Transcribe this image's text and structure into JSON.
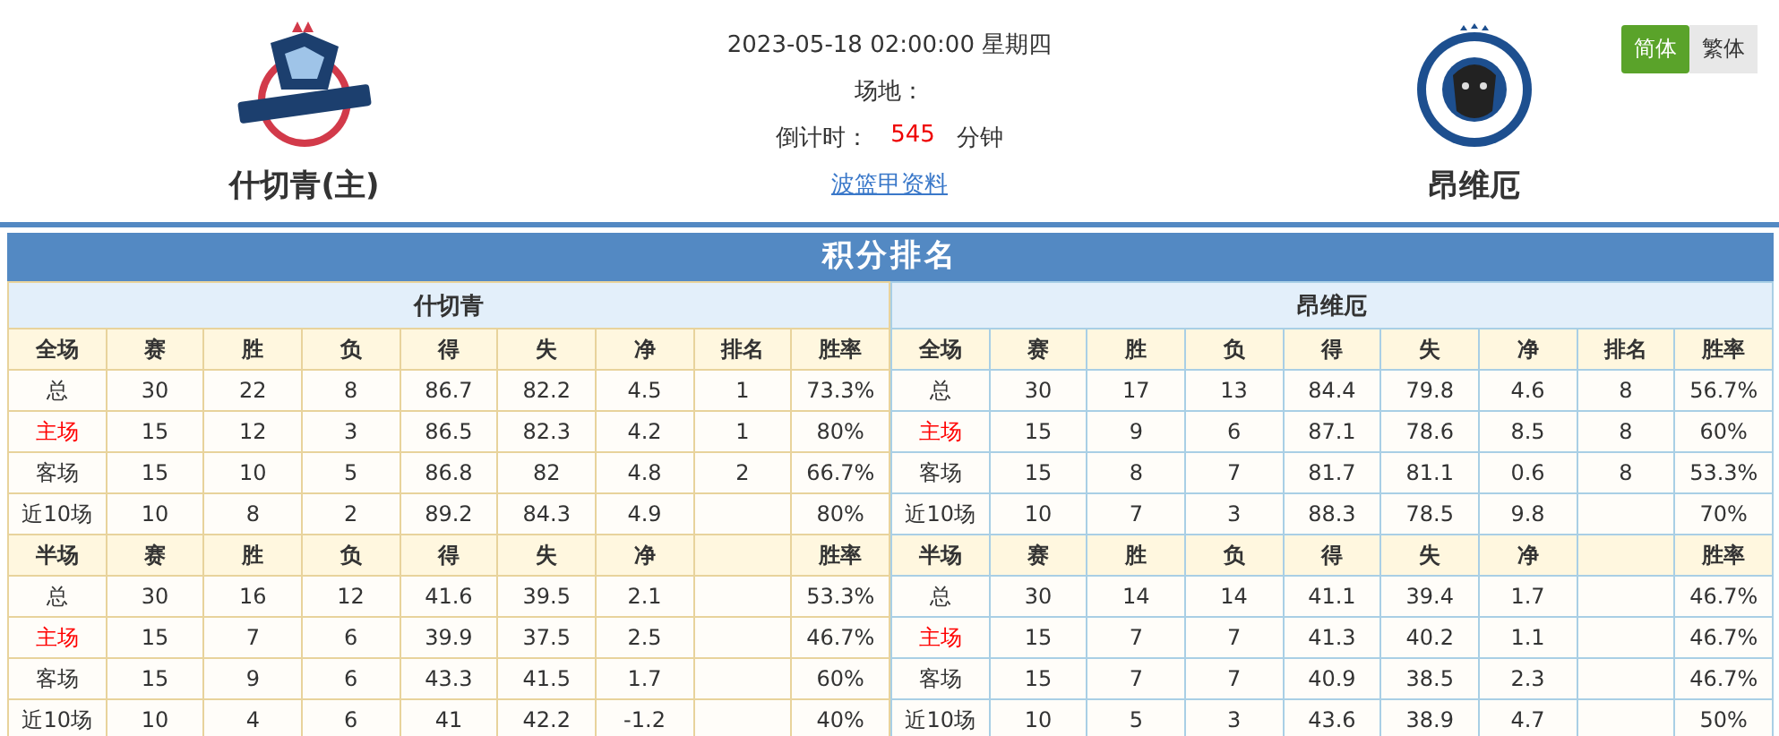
{
  "header": {
    "datetime": "2023-05-18 02:00:00 星期四",
    "venue_label": "场地：",
    "countdown_label": "倒计时：",
    "countdown_value": "545",
    "countdown_unit": "分钟",
    "link": "波篮甲资料",
    "home": {
      "name": "什切青(主)"
    },
    "away": {
      "name": "昂维厄"
    }
  },
  "lang_toggle": [
    {
      "label": "简体",
      "selected": true
    },
    {
      "label": "繁体",
      "selected": false
    }
  ],
  "standings": {
    "title": "积分排名",
    "tables": [
      {
        "team": "什切青",
        "sections": [
          {
            "header": {
              "label": "全场",
              "games": "赛",
              "wins": "胜",
              "losses": "负",
              "scored": "得",
              "conceded": "失",
              "net": "净",
              "rank": "排名",
              "win_rate": "胜率"
            },
            "rows": [
              {
                "highlight": false,
                "label": "总",
                "games": "30",
                "wins": "22",
                "losses": "8",
                "scored": "86.7",
                "conceded": "82.2",
                "net": "4.5",
                "rank": "1",
                "win_rate": "73.3%"
              },
              {
                "highlight": true,
                "label": "主场",
                "games": "15",
                "wins": "12",
                "losses": "3",
                "scored": "86.5",
                "conceded": "82.3",
                "net": "4.2",
                "rank": "1",
                "win_rate": "80%"
              },
              {
                "highlight": false,
                "label": "客场",
                "games": "15",
                "wins": "10",
                "losses": "5",
                "scored": "86.8",
                "conceded": "82",
                "net": "4.8",
                "rank": "2",
                "win_rate": "66.7%"
              },
              {
                "highlight": false,
                "label": "近10场",
                "games": "10",
                "wins": "8",
                "losses": "2",
                "scored": "89.2",
                "conceded": "84.3",
                "net": "4.9",
                "win_rate": "80%"
              }
            ]
          },
          {
            "header": {
              "label": "半场",
              "games": "赛",
              "wins": "胜",
              "losses": "负",
              "scored": "得",
              "conceded": "失",
              "net": "净",
              "win_rate": "胜率"
            },
            "rows": [
              {
                "highlight": false,
                "label": "总",
                "games": "30",
                "wins": "16",
                "losses": "12",
                "scored": "41.6",
                "conceded": "39.5",
                "net": "2.1",
                "win_rate": "53.3%"
              },
              {
                "highlight": true,
                "label": "主场",
                "games": "15",
                "wins": "7",
                "losses": "6",
                "scored": "39.9",
                "conceded": "37.5",
                "net": "2.5",
                "win_rate": "46.7%"
              },
              {
                "highlight": false,
                "label": "客场",
                "games": "15",
                "wins": "9",
                "losses": "6",
                "scored": "43.3",
                "conceded": "41.5",
                "net": "1.7",
                "win_rate": "60%"
              },
              {
                "highlight": false,
                "label": "近10场",
                "games": "10",
                "wins": "4",
                "losses": "6",
                "scored": "41",
                "conceded": "42.2",
                "net": "-1.2",
                "win_rate": "40%"
              }
            ]
          }
        ]
      },
      {
        "team": "昂维厄",
        "sections": [
          {
            "header": {
              "label": "全场",
              "games": "赛",
              "wins": "胜",
              "losses": "负",
              "scored": "得",
              "conceded": "失",
              "net": "净",
              "rank": "排名",
              "win_rate": "胜率"
            },
            "rows": [
              {
                "highlight": false,
                "label": "总",
                "games": "30",
                "wins": "17",
                "losses": "13",
                "scored": "84.4",
                "conceded": "79.8",
                "net": "4.6",
                "rank": "8",
                "win_rate": "56.7%"
              },
              {
                "highlight": true,
                "label": "主场",
                "games": "15",
                "wins": "9",
                "losses": "6",
                "scored": "87.1",
                "conceded": "78.6",
                "net": "8.5",
                "rank": "8",
                "win_rate": "60%"
              },
              {
                "highlight": false,
                "label": "客场",
                "games": "15",
                "wins": "8",
                "losses": "7",
                "scored": "81.7",
                "conceded": "81.1",
                "net": "0.6",
                "rank": "8",
                "win_rate": "53.3%"
              },
              {
                "highlight": false,
                "label": "近10场",
                "games": "10",
                "wins": "7",
                "losses": "3",
                "scored": "88.3",
                "conceded": "78.5",
                "net": "9.8",
                "win_rate": "70%"
              }
            ]
          },
          {
            "header": {
              "label": "半场",
              "games": "赛",
              "wins": "胜",
              "losses": "负",
              "scored": "得",
              "conceded": "失",
              "net": "净",
              "win_rate": "胜率"
            },
            "rows": [
              {
                "highlight": false,
                "label": "总",
                "games": "30",
                "wins": "14",
                "losses": "14",
                "scored": "41.1",
                "conceded": "39.4",
                "net": "1.7",
                "win_rate": "46.7%"
              },
              {
                "highlight": true,
                "label": "主场",
                "games": "15",
                "wins": "7",
                "losses": "7",
                "scored": "41.3",
                "conceded": "40.2",
                "net": "1.1",
                "win_rate": "46.7%"
              },
              {
                "highlight": false,
                "label": "客场",
                "games": "15",
                "wins": "7",
                "losses": "7",
                "scored": "40.9",
                "conceded": "38.5",
                "net": "2.3",
                "win_rate": "46.7%"
              },
              {
                "highlight": false,
                "label": "近10场",
                "games": "10",
                "wins": "5",
                "losses": "3",
                "scored": "43.6",
                "conceded": "38.9",
                "net": "4.7",
                "win_rate": "50%"
              }
            ]
          }
        ]
      }
    ]
  }
}
